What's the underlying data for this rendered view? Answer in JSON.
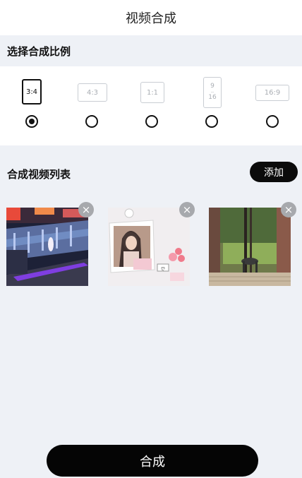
{
  "header": {
    "title": "视频合成"
  },
  "ratio_section": {
    "label": "选择合成比例",
    "options": [
      {
        "label": "3:4",
        "selected": true
      },
      {
        "label": "4:3",
        "selected": false
      },
      {
        "label": "1:1",
        "selected": false
      },
      {
        "label_top": "9",
        "label_mid": "--",
        "label_bottom": "16",
        "selected": false
      },
      {
        "label": "16:9",
        "selected": false
      }
    ]
  },
  "video_list": {
    "title": "合成视频列表",
    "add_label": "添加",
    "close_glyph": "×",
    "items": [
      {
        "icon": "concert-stage-thumbnail"
      },
      {
        "icon": "girl-photo-frame-thumbnail"
      },
      {
        "icon": "balcony-garden-thumbnail"
      }
    ]
  },
  "compose_button": {
    "label": "合成"
  }
}
